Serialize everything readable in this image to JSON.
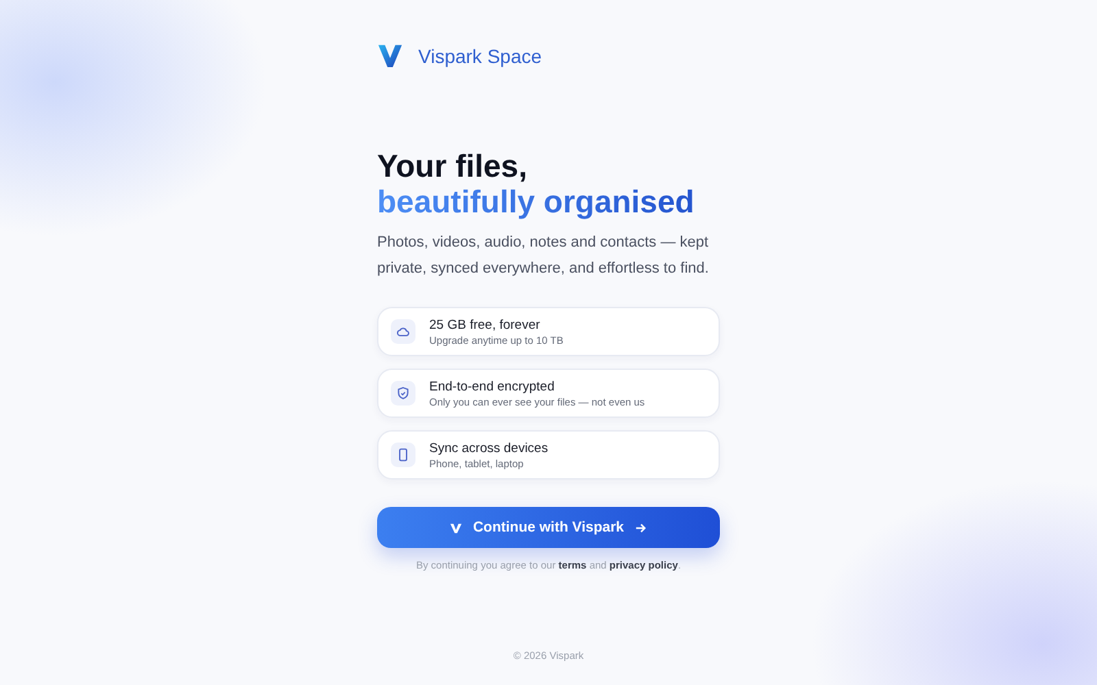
{
  "brand": {
    "name": "Vispark Space"
  },
  "hero": {
    "title_line_1": "Your files,",
    "title_line_2": "beautifully organised",
    "subtitle": "Photos, videos, audio, notes and contacts — kept private, synced everywhere, and effortless to find."
  },
  "features": [
    {
      "title": "25 GB free, forever",
      "subtitle": "Upgrade anytime up to 10 TB"
    },
    {
      "title": "End-to-end encrypted",
      "subtitle": "Only you can ever see your files — not even us"
    },
    {
      "title": "Sync across devices",
      "subtitle": "Phone, tablet, laptop"
    }
  ],
  "cta": {
    "label": "Continue with Vispark"
  },
  "consent": {
    "before": "By continuing you agree to our",
    "terms_link": "terms",
    "joiner": "and",
    "privacy_link": "privacy policy",
    "end": "."
  },
  "footer": {
    "copyright": "© 2026 Vispark"
  }
}
